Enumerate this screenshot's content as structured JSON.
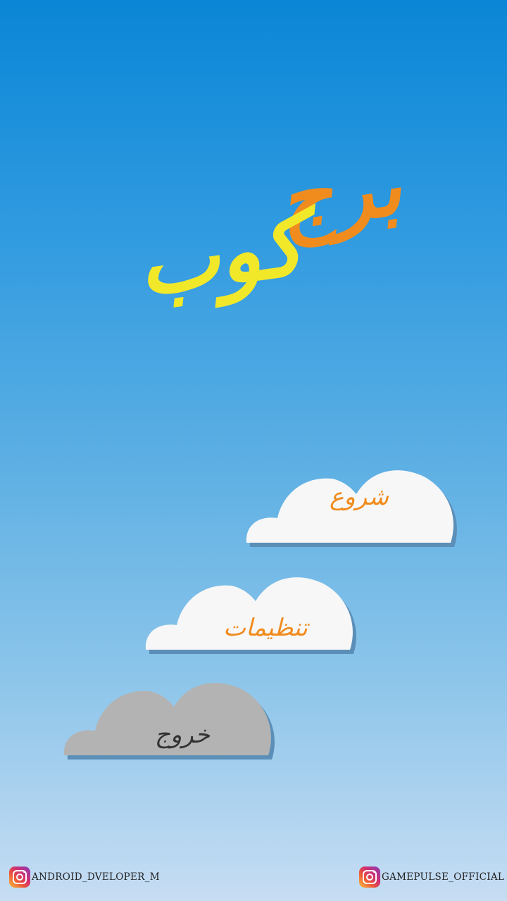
{
  "title": {
    "word1": "برج",
    "word2": "کوب",
    "word1_color": "#f08c1e",
    "word2_color": "#f2e82a"
  },
  "menu": {
    "start": {
      "label": "شروع",
      "color": "#f08c1e",
      "cloud_color": "#f7f7f7"
    },
    "settings": {
      "label": "تنظیمات",
      "color": "#f08c1e",
      "cloud_color": "#f7f7f7"
    },
    "exit": {
      "label": "خروج",
      "color": "#333333",
      "cloud_color": "#b3b3b3"
    }
  },
  "social": {
    "left": {
      "icon": "instagram-icon",
      "handle": "ANDROID_DVELOPER_M"
    },
    "right": {
      "icon": "instagram-icon",
      "handle": "GAMEPULSE_OFFICIAL"
    }
  },
  "colors": {
    "sky_top": "#0a86d6",
    "sky_bottom": "#c7ddf3",
    "cloud_shadow": "#5b8fb8"
  }
}
